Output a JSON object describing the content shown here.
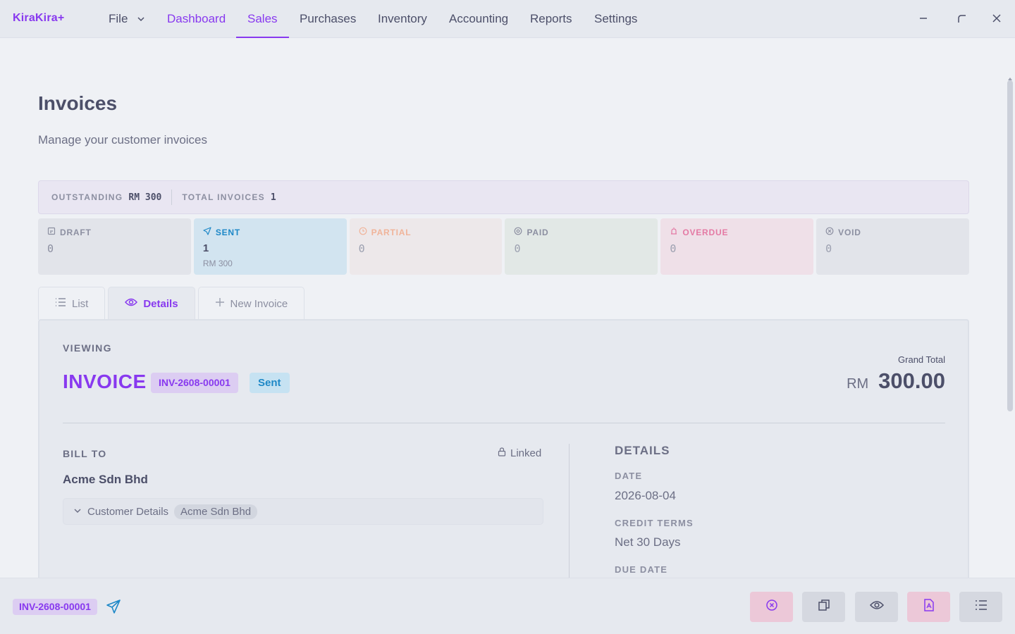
{
  "app": {
    "brand": "KiraKira+"
  },
  "menu": {
    "file": "File",
    "items": [
      "Dashboard",
      "Sales",
      "Purchases",
      "Inventory",
      "Accounting",
      "Reports",
      "Settings"
    ]
  },
  "page": {
    "title": "Invoices",
    "subtitle": "Manage your customer invoices"
  },
  "summary": {
    "outstanding_label": "OUTSTANDING",
    "outstanding_value": "RM 300",
    "total_label": "TOTAL INVOICES",
    "total_value": "1"
  },
  "status_cards": [
    {
      "label": "DRAFT",
      "count": "0",
      "amount": "",
      "color": "#8c8fa1",
      "bg": "#e2e4ea",
      "icon": "draft-icon"
    },
    {
      "label": "SENT",
      "count": "1",
      "amount": "RM 300",
      "color": "#1e88c7",
      "bg": "#d2e4f0",
      "icon": "send-icon"
    },
    {
      "label": "PARTIAL",
      "count": "0",
      "amount": "",
      "color": "#f0b49a",
      "bg": "#ede8ea",
      "icon": "partial-clock-icon"
    },
    {
      "label": "PAID",
      "count": "0",
      "amount": "",
      "color": "#8c8fa1",
      "bg": "#e2e8e6",
      "icon": "paid-check-icon"
    },
    {
      "label": "OVERDUE",
      "count": "0",
      "amount": "",
      "color": "#e47aa4",
      "bg": "#efe0e8",
      "icon": "overdue-alarm-icon"
    },
    {
      "label": "VOID",
      "count": "0",
      "amount": "",
      "color": "#8c8fa1",
      "bg": "#e2e4ea",
      "icon": "void-x-icon"
    }
  ],
  "tabs": {
    "list": "List",
    "details": "Details",
    "new": "New Invoice"
  },
  "invoice": {
    "viewing_label": "VIEWING",
    "title": "INVOICE",
    "number": "INV-2608-00001",
    "status": "Sent",
    "grand_total_label": "Grand Total",
    "currency": "RM",
    "grand_total": "300.00"
  },
  "bill_to": {
    "label": "BILL TO",
    "linked": "Linked",
    "customer": "Acme Sdn Bhd",
    "details_toggle": "Customer Details",
    "details_chip": "Acme Sdn Bhd"
  },
  "details": {
    "heading": "DETAILS",
    "date_label": "DATE",
    "date": "2026-08-04",
    "terms_label": "CREDIT TERMS",
    "terms": "Net 30 Days",
    "due_label": "DUE DATE"
  },
  "footer": {
    "number": "INV-2608-00001"
  },
  "colors": {
    "accent": "#8839ef",
    "sent": "#1e88c7"
  }
}
